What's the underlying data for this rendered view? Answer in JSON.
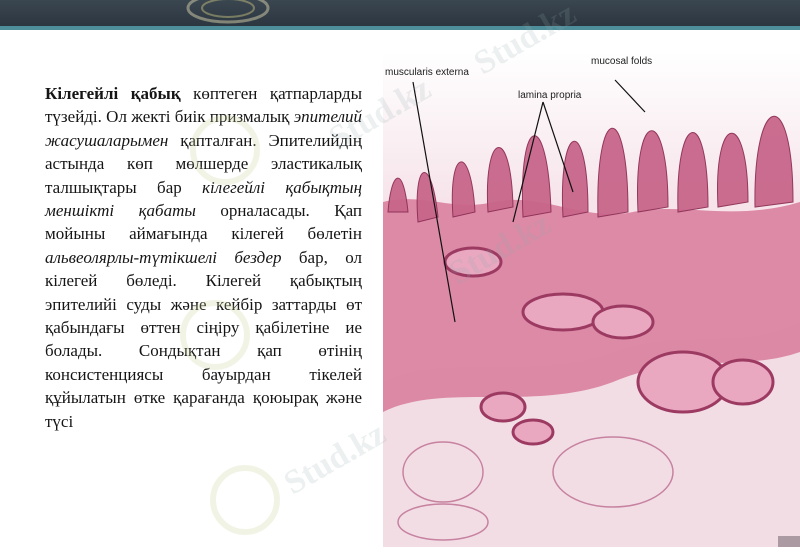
{
  "paragraph": {
    "term": "Кілегейлі қабық",
    "part1": " көптеген қатпарларды түзейді. Ол жекті биік призмалық ",
    "italic1": "эпителий жасушаларымен",
    "part2": " қапталған. Эпителийдің астында көп мөлшерде эластикалық талшықтары бар ",
    "italic2": "кілегейлі қабықтың меншікті қабаты",
    "part3": " орналасады. Қап мойыны аймағында кілегей бөлетін ",
    "italic3": "альвеолярлы-түтікшелі бездер",
    "part4": " бар, ол кілегей бөледі. Кілегей қабықтың эпителийі суды және кейбір заттарды өт қабындағы өттен сіңіру қабілетіне ие болады. Сондықтан қап өтінің консистенциясы бауырдан тікелей құйылатын өтке қарағанда қоюырақ және түсі"
  },
  "figure": {
    "labels": {
      "muscularis": "muscularis externa",
      "lamina": "lamina propria",
      "mucosal": "mucosal folds"
    }
  },
  "watermark": "Stud.kz",
  "colors": {
    "topbar": "#2c3640",
    "accent_line": "#4e8e9a",
    "tissue_pink": "#d9809f",
    "tissue_light": "#f3dce4"
  }
}
